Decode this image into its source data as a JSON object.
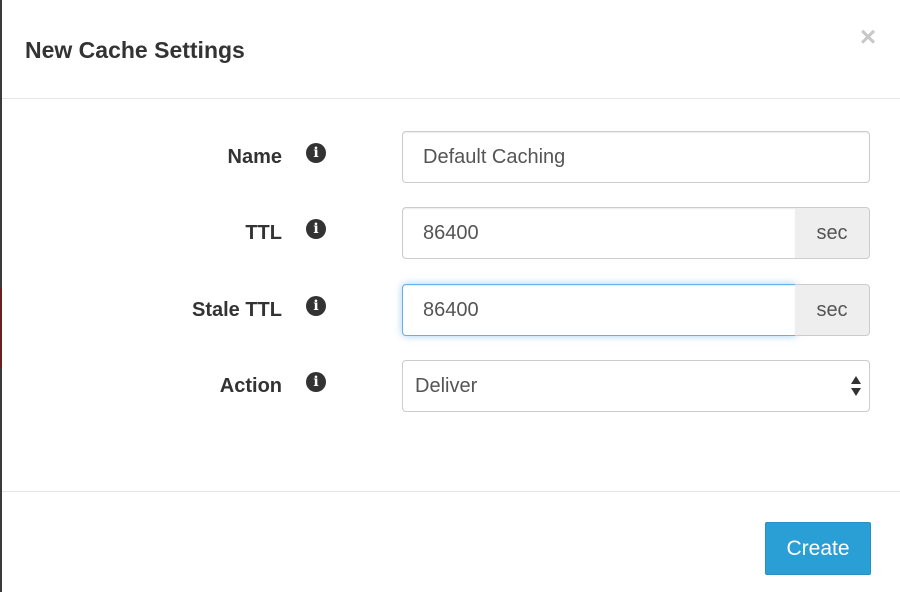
{
  "modal": {
    "title": "New Cache Settings",
    "close_glyph": "×"
  },
  "form": {
    "info_glyph": "i",
    "rows": [
      {
        "label": "Name",
        "value": "Default Caching"
      },
      {
        "label": "TTL",
        "value": "86400",
        "unit": "sec"
      },
      {
        "label": "Stale TTL",
        "value": "86400",
        "unit": "sec"
      },
      {
        "label": "Action",
        "value": "Deliver"
      }
    ]
  },
  "footer": {
    "create_label": "Create"
  },
  "colors": {
    "primary_button": "#2a9fd6",
    "focus_border": "#66afe9",
    "addon_background": "#eeeeee"
  },
  "icons": [
    "close-icon",
    "info-icon",
    "select-arrows-icon"
  ]
}
